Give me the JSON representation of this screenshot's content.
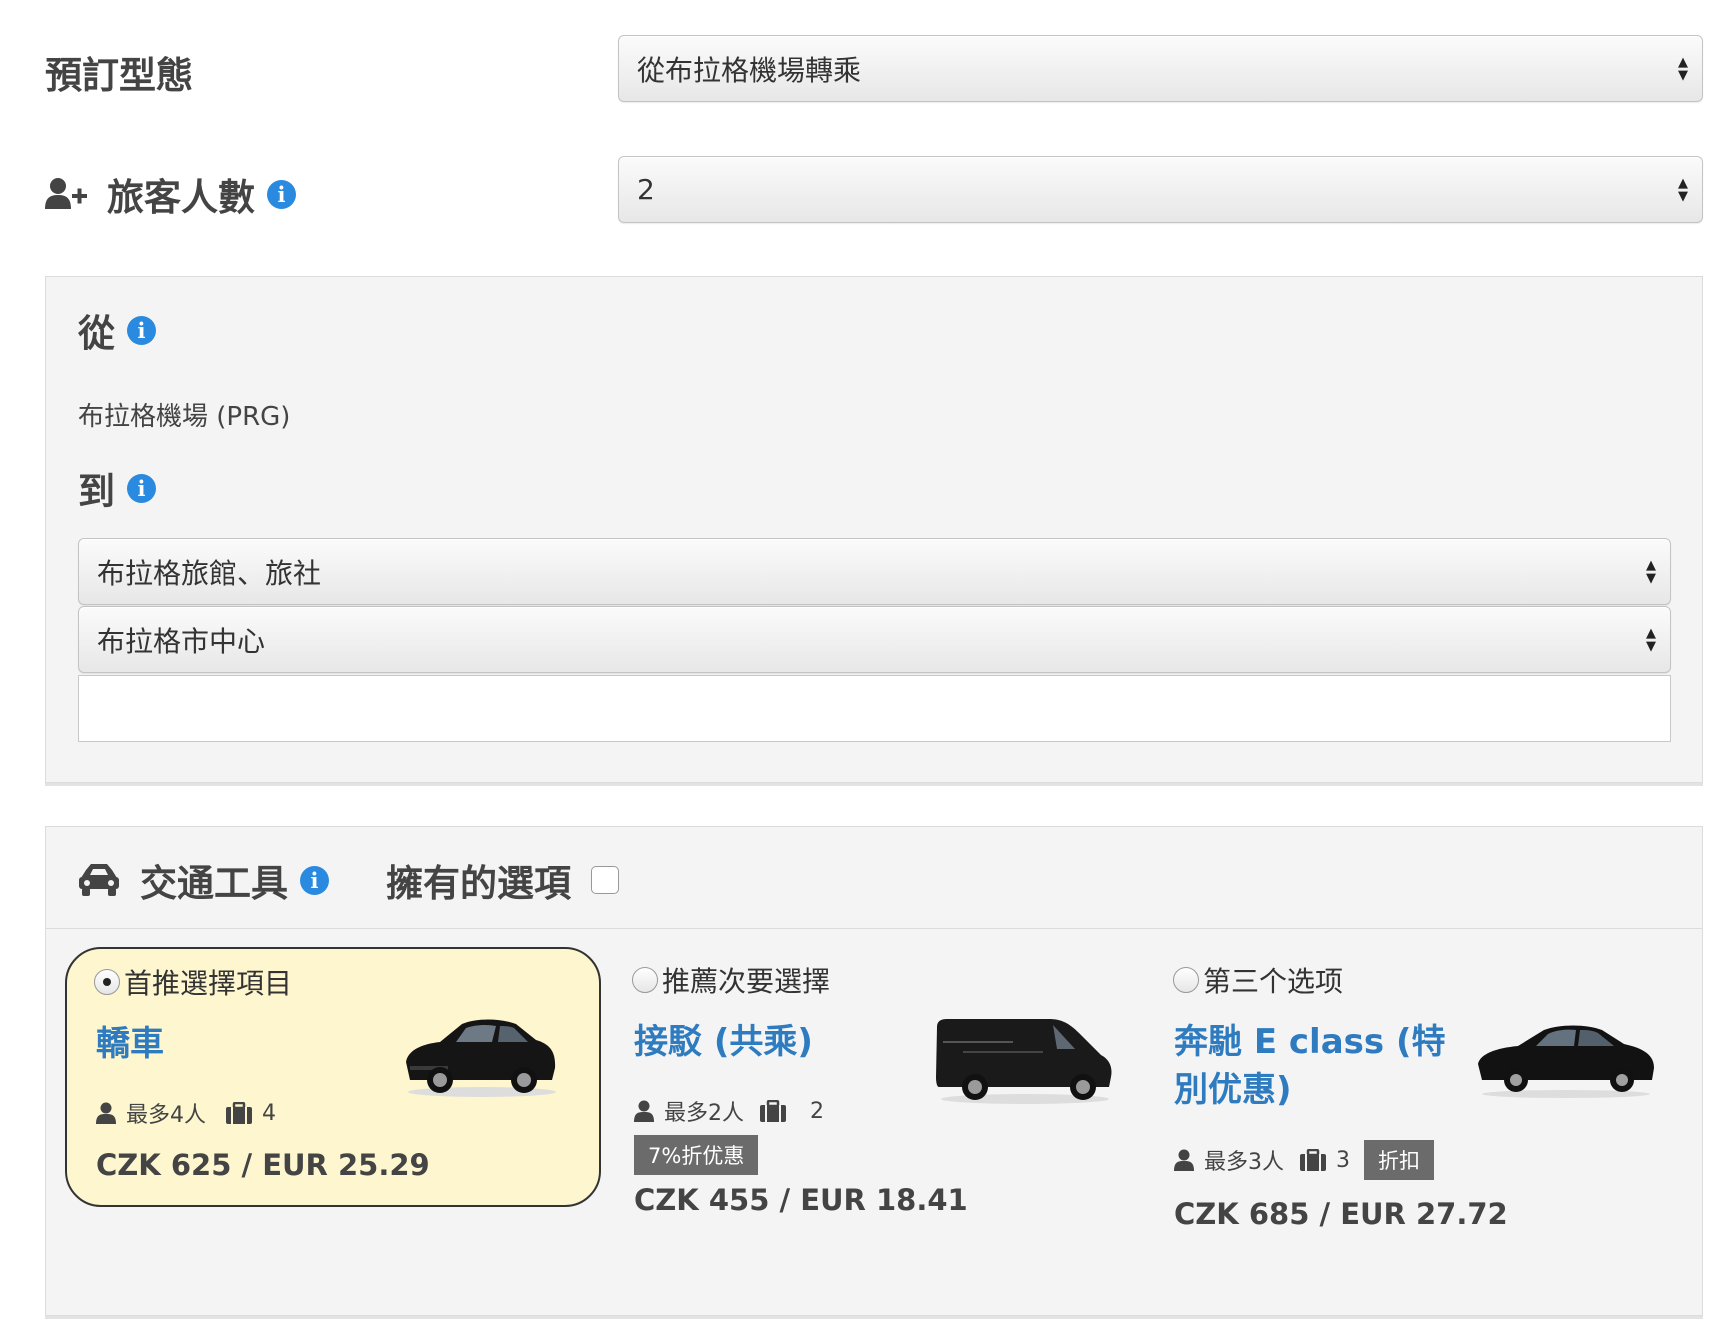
{
  "booking_type": {
    "label": "預訂型態",
    "selected": "從布拉格機場轉乘"
  },
  "passengers": {
    "label": "旅客人數",
    "selected": "2"
  },
  "route": {
    "from_label": "從",
    "from_value": "布拉格機場 (PRG)",
    "to_label": "到",
    "to_category": "布拉格旅館、旅社",
    "to_area": "布拉格市中心",
    "address_value": ""
  },
  "vehicles": {
    "title": "交通工具",
    "owned_options_label": "擁有的選項",
    "options": [
      {
        "radio_label": "首推選擇項目",
        "name": "轎車",
        "max_people": "最多4人",
        "luggage": "4",
        "price": "CZK 625 / EUR 25.29",
        "selected": true
      },
      {
        "radio_label": "推薦次要選擇",
        "name": "接駁 (共乘)",
        "max_people": "最多2人",
        "luggage": "2",
        "discount": "7%折优惠",
        "price": "CZK 455 / EUR 18.41",
        "selected": false
      },
      {
        "radio_label": "第三个选项",
        "name": "奔馳 E class (特別优惠)",
        "max_people": "最多3人",
        "luggage": "3",
        "discount": "折扣",
        "price": "CZK 685 / EUR 27.72",
        "selected": false
      }
    ]
  },
  "colors": {
    "link_blue": "#2e7bbf",
    "info_blue": "#2a8ae0",
    "selected_bg": "#fdf6cf",
    "badge_gray": "#6b6b6b"
  },
  "icons": [
    "user-plus-icon",
    "info-icon",
    "taxi-icon",
    "user-icon",
    "briefcase-icon",
    "car-image",
    "van-image",
    "mercedes-image"
  ]
}
